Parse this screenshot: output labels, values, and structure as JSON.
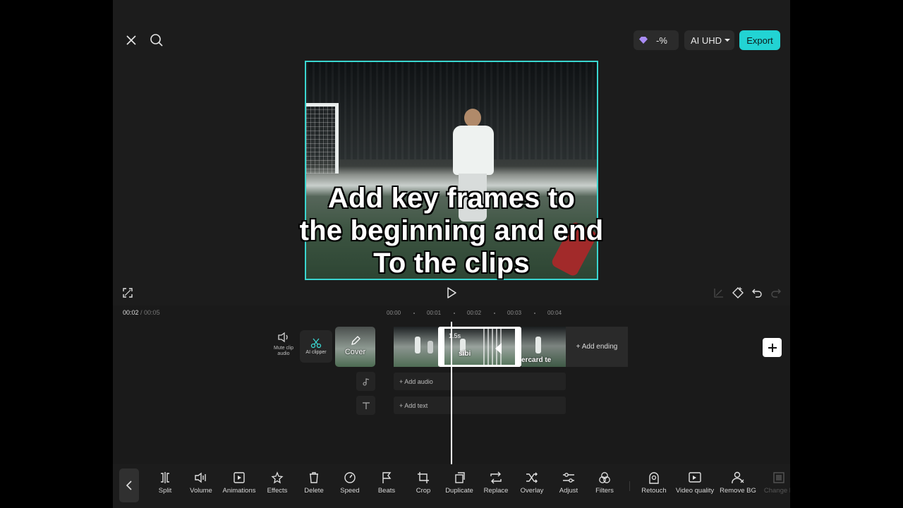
{
  "header": {
    "credits_label": "-%",
    "quality_label": "AI UHD",
    "export_label": "Export"
  },
  "preview": {
    "caption_lines": [
      "Add key frames to",
      "the beginning and end",
      "To the clips"
    ]
  },
  "timeline": {
    "current_time": "00:02",
    "total_time": "/ 00:05",
    "ruler": [
      "00:00",
      "00:01",
      "00:02",
      "00:03",
      "00:04"
    ],
    "mute_label": "Mute clip audio",
    "ai_clipper_label": "AI clipper",
    "cover_label": "Cover",
    "selected_clip_duration": "1.5s",
    "clip_overlay_text": "sibi",
    "clip3_overlay_text": "ercard  te",
    "add_ending_label": "+ Add ending",
    "add_audio_label": "+ Add audio",
    "add_text_label": "+ Add text"
  },
  "toolbar": {
    "items": [
      {
        "label": "Split",
        "icon": "split-icon"
      },
      {
        "label": "Volume",
        "icon": "volume-icon"
      },
      {
        "label": "Animations",
        "icon": "animations-icon"
      },
      {
        "label": "Effects",
        "icon": "effects-icon"
      },
      {
        "label": "Delete",
        "icon": "delete-icon"
      },
      {
        "label": "Speed",
        "icon": "speed-icon"
      },
      {
        "label": "Beats",
        "icon": "beats-icon"
      },
      {
        "label": "Crop",
        "icon": "crop-icon"
      },
      {
        "label": "Duplicate",
        "icon": "duplicate-icon"
      },
      {
        "label": "Replace",
        "icon": "replace-icon"
      },
      {
        "label": "Overlay",
        "icon": "overlay-icon"
      },
      {
        "label": "Adjust",
        "icon": "adjust-icon"
      },
      {
        "label": "Filters",
        "icon": "filters-icon"
      },
      {
        "label": "Retouch",
        "icon": "retouch-icon"
      },
      {
        "label": "Video quality",
        "icon": "video-quality-icon"
      },
      {
        "label": "Remove BG",
        "icon": "remove-bg-icon"
      },
      {
        "label": "Change B",
        "icon": "change-bg-icon"
      }
    ]
  },
  "colors": {
    "accent": "#22d3d3",
    "background": "#1c1c1c"
  }
}
